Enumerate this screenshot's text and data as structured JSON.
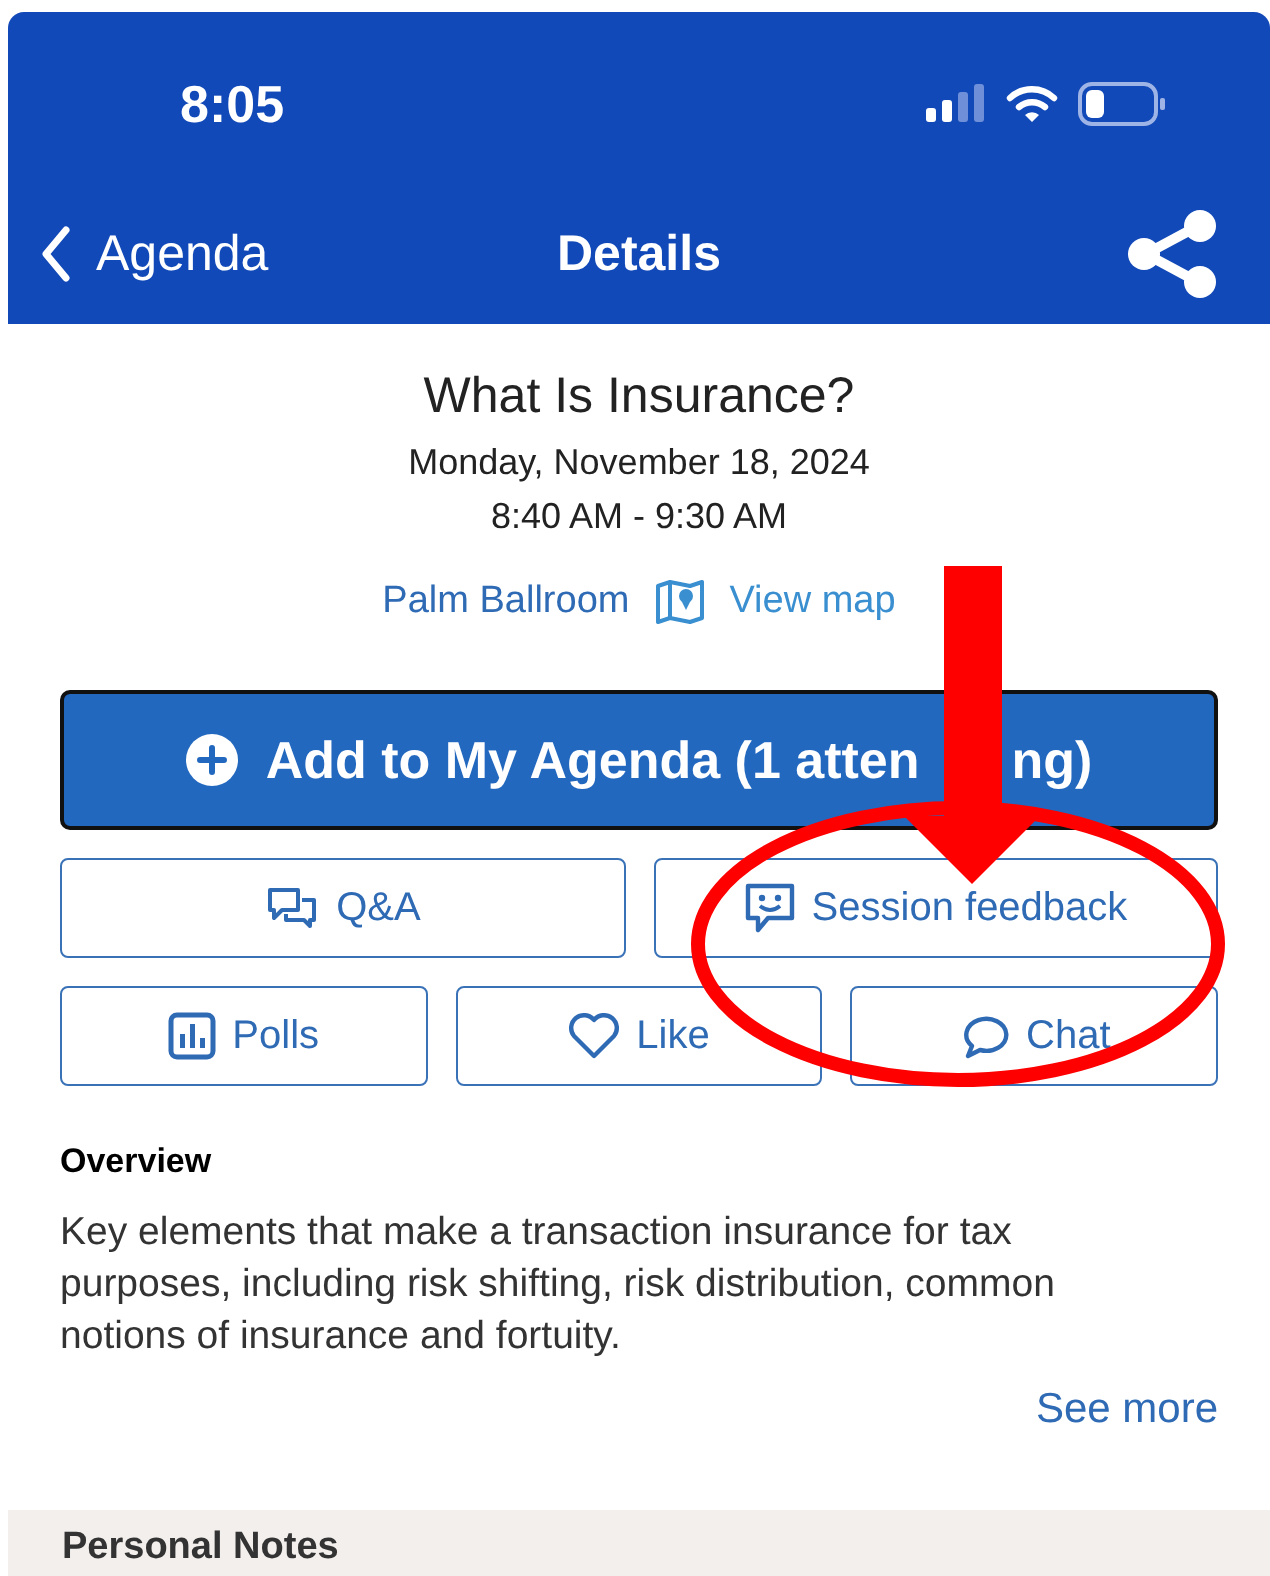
{
  "status_bar": {
    "time": "8:05"
  },
  "nav": {
    "back_label": "Agenda",
    "title": "Details"
  },
  "session": {
    "title": "What Is Insurance?",
    "date": "Monday, November 18, 2024",
    "time": "8:40 AM - 9:30 AM",
    "location": "Palm Ballroom",
    "map_link": "View map"
  },
  "primary_button": {
    "label_parts": [
      "Add to My Agenda (1 atten",
      "ng)"
    ]
  },
  "action_rows": [
    [
      {
        "kind": "qa",
        "label": "Q&A"
      },
      {
        "kind": "feedback",
        "label": "Session feedback"
      }
    ],
    [
      {
        "kind": "polls",
        "label": "Polls"
      },
      {
        "kind": "like",
        "label": "Like"
      },
      {
        "kind": "chat",
        "label": "Chat"
      }
    ]
  ],
  "overview": {
    "heading": "Overview",
    "text": "Key elements that make a transaction insurance for tax purposes, including risk shifting, risk distribution, common notions of insurance and fortuity.",
    "more_link": "See more"
  },
  "section_band": {
    "title": "Personal Notes"
  },
  "annotation": {
    "kind": "arrow-and-ellipse"
  }
}
